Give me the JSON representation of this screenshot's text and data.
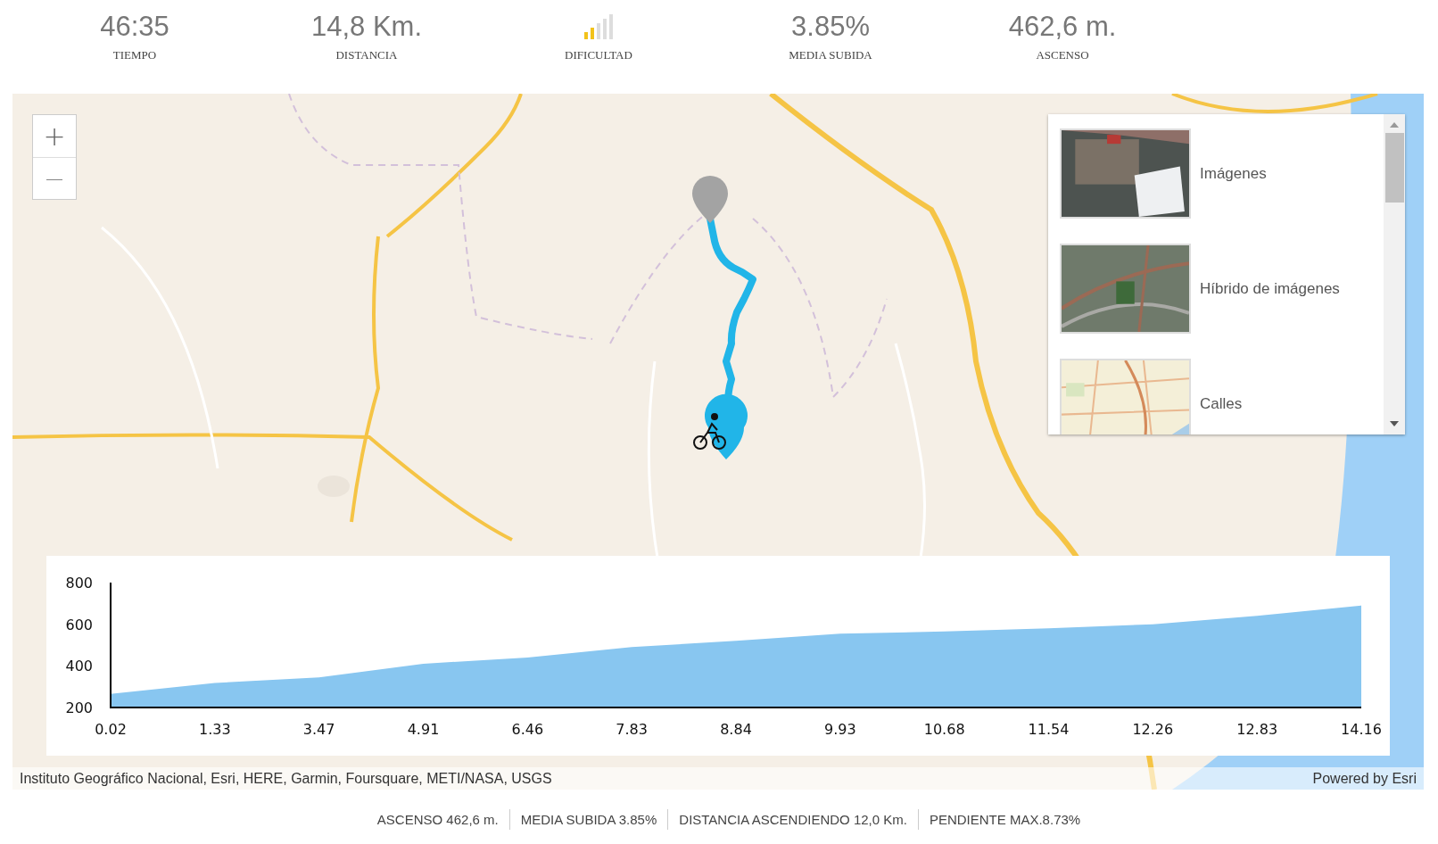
{
  "stats": [
    {
      "kind": "value",
      "value": "46:35",
      "label": "TIEMPO"
    },
    {
      "kind": "value",
      "value": "14,8 Km.",
      "label": "DISTANCIA"
    },
    {
      "kind": "meter",
      "level": 0.4,
      "label": "DIFICULTAD"
    },
    {
      "kind": "value",
      "value": "3.85%",
      "label": "MEDIA SUBIDA"
    },
    {
      "kind": "value",
      "value": "462,6 m.",
      "label": "ASCENSO"
    }
  ],
  "map": {
    "kind": "picture",
    "zoom_buttons": [
      "+",
      "—"
    ],
    "basemap_gallery": {
      "items": [
        {
          "label": "Imágenes",
          "selected": false
        },
        {
          "label": "Híbrido de imágenes",
          "selected": false
        },
        {
          "label": "Calles",
          "selected": false
        }
      ]
    },
    "elevation_profile": {
      "chart_data": {
        "type": "area",
        "categories": [
          "0.02",
          "1.33",
          "3.47",
          "4.91",
          "6.46",
          "7.83",
          "8.84",
          "9.93",
          "10.68",
          "11.54",
          "12.26",
          "12.83",
          "14.16"
        ],
        "series": [
          {
            "color": "#88c6f0",
            "values": [
              265,
              318,
              345,
              410,
              440,
              490,
              520,
              555,
              565,
              580,
              600,
              640,
              690
            ]
          }
        ],
        "ylim": [
          200,
          800
        ],
        "yticks": [
          200,
          400,
          600,
          800
        ]
      }
    },
    "attribution": "Instituto Geográfico Nacional, Esri, HERE, Garmin, Foursquare, METI/NASA, USGS",
    "powered_by": "Powered by Esri"
  },
  "summary": [
    "ASCENSO 462,6 m.",
    "MEDIA SUBIDA 3.85%",
    "DISTANCIA ASCENDIENDO 12,0 Km.",
    "PENDIENTE MAX.8.73%"
  ]
}
